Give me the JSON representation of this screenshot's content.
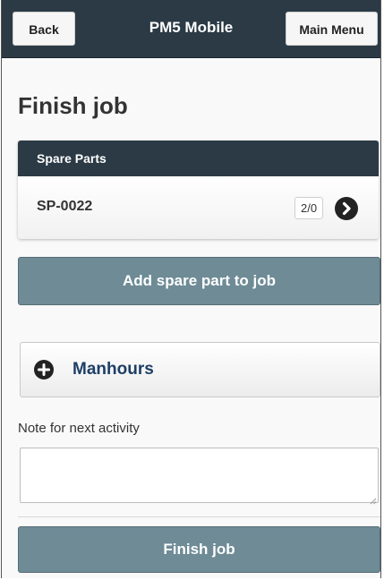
{
  "header": {
    "back_label": "Back",
    "title": "PM5 Mobile",
    "menu_label": "Main Menu"
  },
  "page": {
    "title": "Finish job"
  },
  "spare_parts": {
    "heading": "Spare Parts",
    "items": [
      {
        "id": "SP-0022",
        "count": "2/0"
      }
    ]
  },
  "actions": {
    "add_part_label": "Add spare part to job",
    "finish_label": "Finish job"
  },
  "manhours": {
    "label": "Manhours"
  },
  "note": {
    "label": "Note for next activity",
    "value": "",
    "placeholder": ""
  },
  "icons": {
    "chevron": "chevron-right-circle-icon",
    "plus": "plus-circle-icon"
  },
  "colors": {
    "header_bg": "#2b3a45",
    "button_bg": "#6e8b96",
    "accent_text": "#1e3f66"
  }
}
